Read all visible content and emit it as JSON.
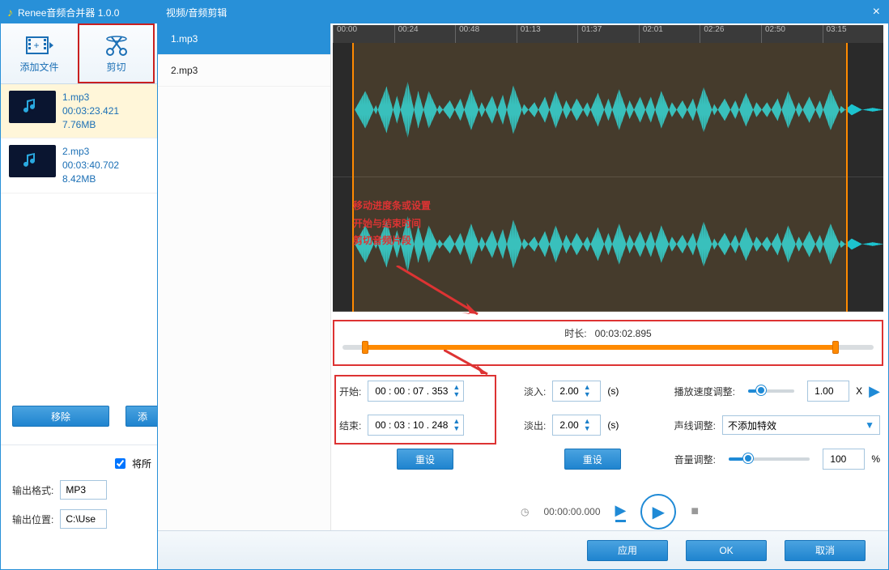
{
  "app": {
    "title": "Renee音频合并器 1.0.0"
  },
  "toolbar": {
    "addFile": "添加文件",
    "cut": "剪切"
  },
  "files": [
    {
      "name": "1.mp3",
      "duration": "00:03:23.421",
      "size": "7.76MB"
    },
    {
      "name": "2.mp3",
      "duration": "00:03:40.702",
      "size": "8.42MB"
    }
  ],
  "mainButtons": {
    "remove": "移除",
    "add": "添"
  },
  "mergeAll": "将所",
  "outputFormatLabel": "输出格式:",
  "outputFormat": "MP3",
  "outputPathLabel": "输出位置:",
  "outputPath": "C:\\Use",
  "dialog": {
    "title": "视频/音频剪辑",
    "tracks": [
      "1.mp3",
      "2.mp3"
    ],
    "ruler": [
      "00:00",
      "00:24",
      "00:48",
      "01:13",
      "01:37",
      "02:01",
      "02:26",
      "02:50",
      "03:15"
    ],
    "durationLabel": "时长:",
    "duration": "00:03:02.895",
    "startLabel": "开始:",
    "start": "00 : 00 : 07 . 353",
    "endLabel": "结束:",
    "end": "00 : 03 : 10 . 248",
    "fadeInLabel": "淡入:",
    "fadeIn": "2.00",
    "secUnit": "(s)",
    "fadeOutLabel": "淡出:",
    "fadeOut": "2.00",
    "speedLabel": "播放速度调整:",
    "speed": "1.00",
    "x": "X",
    "voiceLabel": "声线调整:",
    "voiceValue": "不添加特效",
    "volumeLabel": "音量调整:",
    "volume": "100",
    "pct": "%",
    "reset": "重设",
    "playTime": "00:00:00.000",
    "apply": "应用",
    "ok": "OK",
    "cancel": "取消"
  },
  "annotation": {
    "l1": "移动进度条或设置",
    "l2": "开始与结束时间",
    "l3": "剪切音频片段"
  }
}
